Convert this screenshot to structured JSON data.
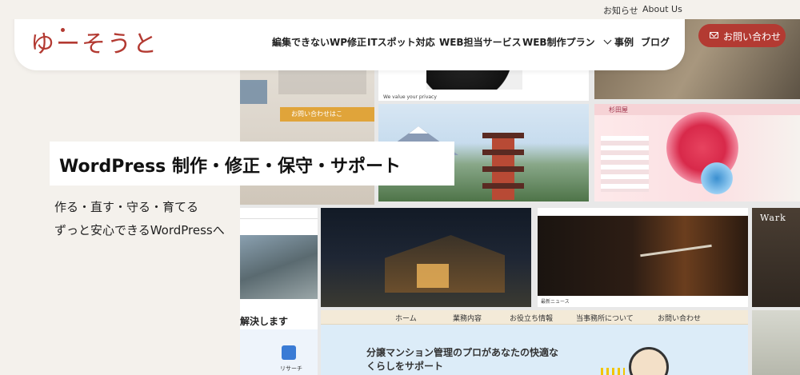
{
  "utility_nav": {
    "news": "お知らせ",
    "about": "About Us"
  },
  "brand": {
    "logo_text": "ゆーそうと",
    "accent_color": "#b33a32"
  },
  "nav": {
    "items": [
      {
        "label": "編集できないWP修正"
      },
      {
        "label": "ITスポット対応"
      },
      {
        "label": "WEB担当サービス"
      },
      {
        "label": "WEB制作プラン"
      },
      {
        "label": "事例"
      },
      {
        "label": "ブログ"
      }
    ],
    "dropdown_icon": "chevron-down-icon"
  },
  "contact_button": {
    "label": "お問い合わせ",
    "icon": "envelope-icon"
  },
  "hero": {
    "title": "WordPress 制作・修正・保守・サポート",
    "subtitle_line1": "作る・直す・守る・育てる",
    "subtitle_line2": "ずっと安心できるWordPressへ"
  },
  "collage": {
    "tile1_button": "お問い合わせはこ",
    "tile2_caption": "We value your privacy",
    "tile5_title": "杉田屋",
    "tile6_heading": "解決します",
    "tile6_label": "リサーチ",
    "tile8_news": "最新ニュース",
    "tile9_title": "Wark",
    "tile10_nav": [
      "ホーム",
      "業務内容",
      "お役立ち情報",
      "当事務所について",
      "お問い合わせ"
    ],
    "tile10_line1": "分譲マンション管理のプロがあなたの快適な",
    "tile10_line2": "くらしをサポート"
  }
}
